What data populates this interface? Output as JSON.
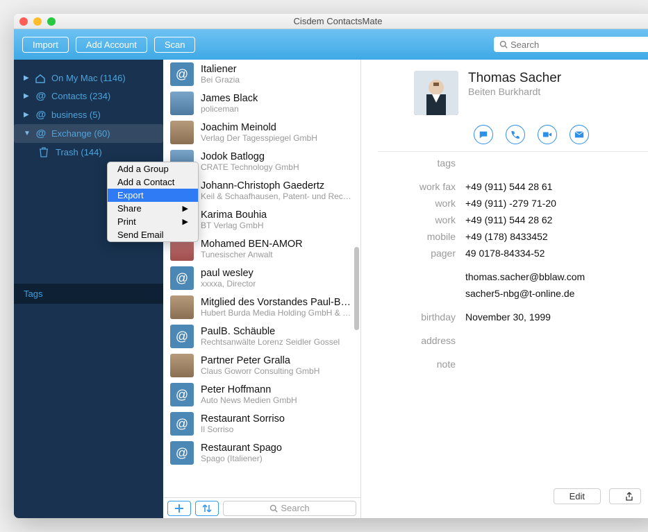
{
  "window": {
    "title": "Cisdem ContactsMate"
  },
  "toolbar": {
    "import": "Import",
    "addAccount": "Add Account",
    "scan": "Scan",
    "searchPlaceholder": "Search"
  },
  "sidebar": {
    "items": [
      {
        "icon": "home",
        "label": "On My Mac (1146)"
      },
      {
        "icon": "at",
        "label": "Contacts (234)"
      },
      {
        "icon": "at",
        "label": "business (5)"
      },
      {
        "icon": "at",
        "label": "Exchange (60)",
        "selected": true,
        "expanded": true
      },
      {
        "icon": "trash",
        "label": "Trash (144)",
        "child": true
      }
    ],
    "tagsHeader": "Tags"
  },
  "contextMenu": {
    "items": [
      {
        "label": "Add a Group"
      },
      {
        "label": "Add a Contact"
      },
      {
        "label": "Export",
        "selected": true
      },
      {
        "label": "Share",
        "submenu": true
      },
      {
        "label": "Print",
        "submenu": true
      },
      {
        "label": "Send Email"
      }
    ]
  },
  "contacts": [
    {
      "name": "Italiener",
      "sub": "Bei Grazia",
      "avatar": "at"
    },
    {
      "name": "James Black",
      "sub": "policeman",
      "avatar": "person2"
    },
    {
      "name": "Joachim Meinold",
      "sub": "Verlag Der Tagesspiegel GmbH",
      "avatar": "person"
    },
    {
      "name": "Jodok Batlogg",
      "sub": "CRATE Technology GmbH",
      "avatar": "person2"
    },
    {
      "name": "Johann-Christoph Gaedertz",
      "sub": "Keil & Schaafhausen, Patent- und Rechtsa...",
      "avatar": "person"
    },
    {
      "name": "Karima Bouhia",
      "sub": "BT Verlag GmbH",
      "avatar": "at"
    },
    {
      "name": "Mohamed BEN-AMOR",
      "sub": "Tunesischer Anwalt",
      "avatar": "person3"
    },
    {
      "name": "paul wesley",
      "sub": "xxxxa, Director",
      "avatar": "at"
    },
    {
      "name": "Mitglied des Vorstandes Paul-Bernh...",
      "sub": "Hubert Burda Media Holding GmbH & Co. ...",
      "avatar": "person"
    },
    {
      "name": "PaulB. Schäuble",
      "sub": "Rechtsanwälte Lorenz Seidler Gossel",
      "avatar": "at"
    },
    {
      "name": "Partner Peter Gralla",
      "sub": "Claus Goworr Consulting GmbH",
      "avatar": "person"
    },
    {
      "name": "Peter Hoffmann",
      "sub": "Auto News Medien GmbH",
      "avatar": "at"
    },
    {
      "name": "Restaurant Sorriso",
      "sub": "Il Sorriso",
      "avatar": "at"
    },
    {
      "name": "Restaurant Spago",
      "sub": "Spago (Italiener)",
      "avatar": "at"
    }
  ],
  "listFooter": {
    "searchPlaceholder": "Search"
  },
  "detail": {
    "name": "Thomas Sacher",
    "company": "Beiten Burkhardt",
    "rows": [
      {
        "label": "tags",
        "value": ""
      },
      {
        "label": "work fax",
        "value": "+49 (911) 544 28 61",
        "spaced": true
      },
      {
        "label": "work",
        "value": "+49 (911) -279 71-20"
      },
      {
        "label": "work",
        "value": "+49 (911) 544 28 62"
      },
      {
        "label": "mobile",
        "value": "+49 (178) 8433452"
      },
      {
        "label": "pager",
        "value": "49 0178-84334-52"
      },
      {
        "label": "",
        "value": "thomas.sacher@bblaw.com",
        "spaced": true
      },
      {
        "label": "",
        "value": "sacher5-nbg@t-online.de"
      },
      {
        "label": "birthday",
        "value": "November 30, 1999",
        "spaced": true
      },
      {
        "label": "address",
        "value": "",
        "spaced": true
      },
      {
        "label": "note",
        "value": "",
        "spaced": true
      }
    ],
    "editLabel": "Edit"
  }
}
